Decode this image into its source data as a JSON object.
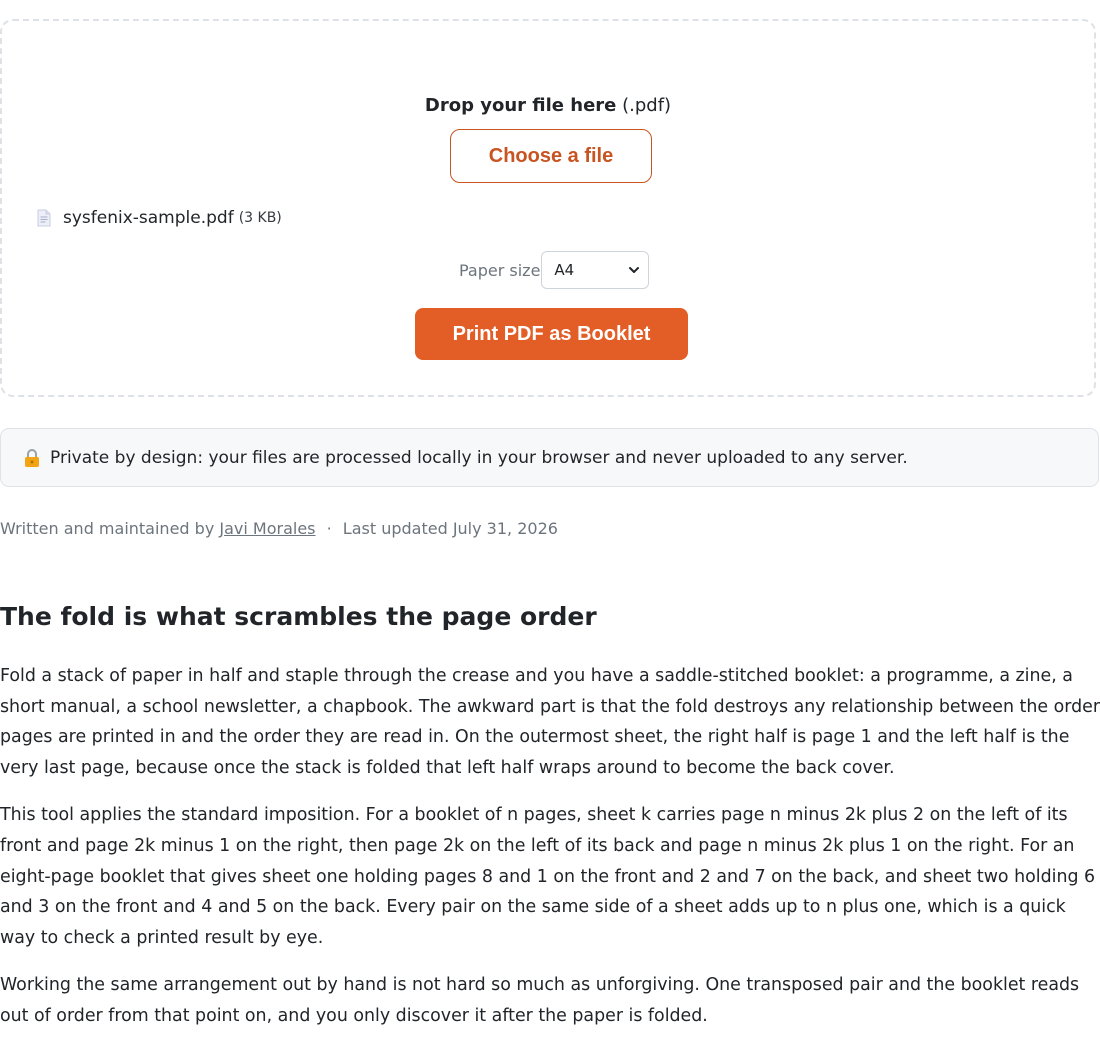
{
  "upload": {
    "drop_strong": "Drop your file here",
    "drop_ext": "(.pdf)",
    "choose_label": "Choose a file",
    "file_name": "sysfenix-sample.pdf",
    "file_size": "(3 KB)",
    "file_icon": "document-icon",
    "paper_label": "Paper size",
    "paper_value": "A4",
    "print_label": "Print PDF as Booklet",
    "accent": "#e35d26"
  },
  "privacy": {
    "icon": "lock-icon",
    "text": "Private by design: your files are processed locally in your browser and never uploaded to any server."
  },
  "byline": {
    "prefix": "Written and maintained by",
    "author": "Javi Morales",
    "separator": "·",
    "updated": "Last updated July 31, 2026"
  },
  "article": {
    "heading": "The fold is what scrambles the page order",
    "paragraphs": [
      "Fold a stack of paper in half and staple through the crease and you have a saddle-stitched booklet: a programme, a zine, a short manual, a school newsletter, a chapbook. The awkward part is that the fold destroys any relationship between the order pages are printed in and the order they are read in. On the outermost sheet, the right half is page 1 and the left half is the very last page, because once the stack is folded that left half wraps around to become the back cover.",
      "This tool applies the standard imposition. For a booklet of n pages, sheet k carries page n minus 2k plus 2 on the left of its front and page 2k minus 1 on the right, then page 2k on the left of its back and page n minus 2k plus 1 on the right. For an eight-page booklet that gives sheet one holding pages 8 and 1 on the front and 2 and 7 on the back, and sheet two holding 6 and 3 on the front and 4 and 5 on the back. Every pair on the same side of a sheet adds up to n plus one, which is a quick way to check a printed result by eye.",
      "Working the same arrangement out by hand is not hard so much as unforgiving. One transposed pair and the booklet reads out of order from that point on, and you only discover it after the paper is folded."
    ]
  }
}
